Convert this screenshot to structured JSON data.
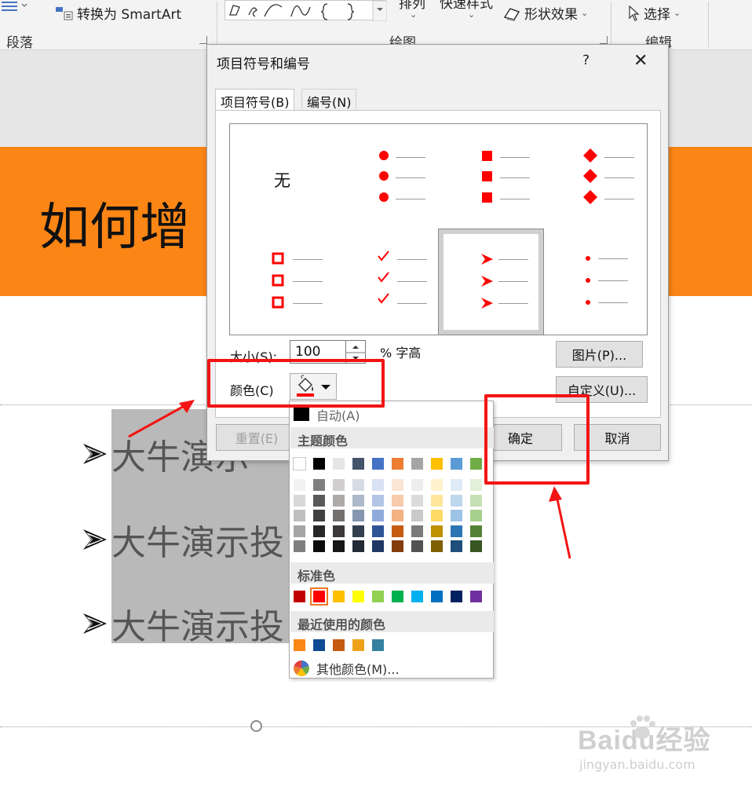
{
  "ribbon": {
    "convert_smartart": "转换为 SmartArt",
    "arrange": "排列",
    "quick_styles": "快速样式",
    "shape_effects": "形状效果",
    "select": "选择",
    "group_paragraph": "段落",
    "group_drawing": "绘图",
    "group_editing": "编辑"
  },
  "slide": {
    "title": "如何增",
    "bullets": [
      "大牛演示",
      "大牛演示投",
      "大牛演示投"
    ]
  },
  "dialog": {
    "title": "项目符号和编号",
    "help": "?",
    "close": "✕",
    "tab_bullets": "项目符号(B)",
    "tab_numbers": "编号(N)",
    "none_label": "无",
    "size_label": "大小(S):",
    "size_value": "100",
    "size_unit": "% 字高",
    "color_label": "颜色(C)",
    "picture_button": "图片(P)...",
    "custom_button": "自定义(U)...",
    "reset_button": "重置(E)",
    "ok_button": "确定",
    "cancel_button": "取消",
    "bullet_color": "#ff0000"
  },
  "color_menu": {
    "auto": "自动(A)",
    "theme_header": "主题颜色",
    "standard_header": "标准色",
    "recent_header": "最近使用的颜色",
    "more_colors": "其他颜色(M)...",
    "theme_row": [
      "#ffffff",
      "#000000",
      "#e7e6e6",
      "#44546a",
      "#4472c4",
      "#ed7d31",
      "#a5a5a5",
      "#ffc000",
      "#5b9bd5",
      "#70ad47"
    ],
    "theme_shades": [
      [
        "#f2f2f2",
        "#7f7f7f",
        "#d0cece",
        "#d6dce4",
        "#d9e2f3",
        "#fbe5d5",
        "#ededed",
        "#fff2cc",
        "#deebf6",
        "#e2efd9"
      ],
      [
        "#d8d8d8",
        "#595959",
        "#aeaaaa",
        "#adb9ca",
        "#b4c6e7",
        "#f7cbac",
        "#dbdbdb",
        "#fee599",
        "#bdd7ee",
        "#c5e0b3"
      ],
      [
        "#bfbfbf",
        "#3f3f3f",
        "#757070",
        "#8496b0",
        "#8eaadb",
        "#f4b183",
        "#c9c9c9",
        "#ffd965",
        "#9cc3e5",
        "#a8d08d"
      ],
      [
        "#a5a5a5",
        "#262626",
        "#3a3838",
        "#323f4f",
        "#2f5496",
        "#c55a11",
        "#7b7b7b",
        "#bf9000",
        "#2e75b5",
        "#538135"
      ],
      [
        "#7f7f7f",
        "#0c0c0c",
        "#171616",
        "#222a35",
        "#1f3864",
        "#833c0b",
        "#525252",
        "#7f6000",
        "#1e4e79",
        "#375623"
      ]
    ],
    "standard": [
      "#c00000",
      "#ff0000",
      "#ffc000",
      "#ffff00",
      "#92d050",
      "#00b050",
      "#00b0f0",
      "#0070c0",
      "#002060",
      "#7030a0"
    ],
    "recent": [
      "#fb8515",
      "#0c4a94",
      "#c55a11",
      "#f0a11a",
      "#35819f"
    ]
  },
  "watermark": {
    "brand": "Baidu经验",
    "url": "jingyan.baidu.com"
  }
}
